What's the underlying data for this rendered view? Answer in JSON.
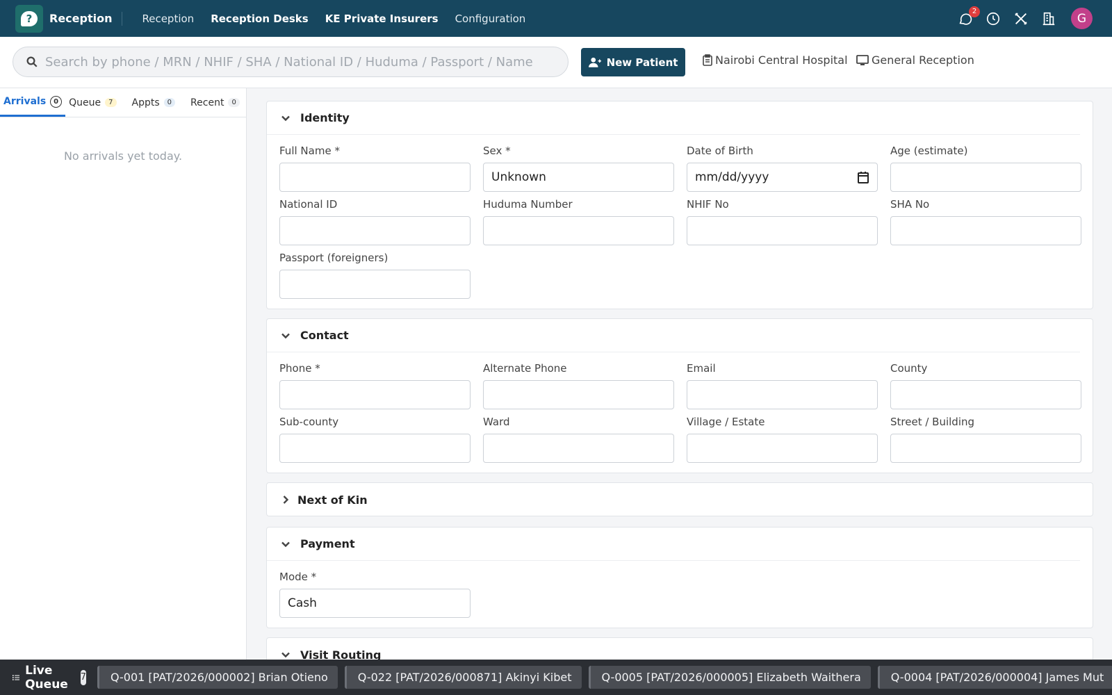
{
  "app": {
    "name": "Reception"
  },
  "nav": [
    "Reception",
    "Reception Desks",
    "KE Private Insurers",
    "Configuration"
  ],
  "notifications": {
    "count": "2"
  },
  "user": {
    "initial": "G"
  },
  "search": {
    "placeholder": "Search by phone / MRN / NHIF / SHA / National ID / Huduma / Passport / Name"
  },
  "actions": {
    "new_patient": "New Patient"
  },
  "context": {
    "facility": "Nairobi Central Hospital",
    "desk": "General Reception"
  },
  "left_tabs": [
    {
      "label": "Arrivals",
      "count": "0"
    },
    {
      "label": "Queue",
      "count": "7"
    },
    {
      "label": "Appts",
      "count": "0"
    },
    {
      "label": "Recent",
      "count": "0"
    }
  ],
  "left_empty": "No arrivals yet today.",
  "identity": {
    "title": "Identity",
    "full_name": "Full Name *",
    "sex": "Sex *",
    "sex_value": "Unknown",
    "dob": "Date of Birth",
    "dob_placeholder": "mm/dd/yyyy",
    "age": "Age (estimate)",
    "national_id": "National ID",
    "huduma": "Huduma Number",
    "nhif": "NHIF No",
    "sha": "SHA No",
    "passport": "Passport (foreigners)"
  },
  "contact": {
    "title": "Contact",
    "phone": "Phone *",
    "alt_phone": "Alternate Phone",
    "email": "Email",
    "county": "County",
    "subcounty": "Sub-county",
    "ward": "Ward",
    "village": "Village / Estate",
    "street": "Street / Building"
  },
  "next_of_kin": {
    "title": "Next of Kin"
  },
  "payment": {
    "title": "Payment",
    "mode": "Mode *",
    "mode_value": "Cash"
  },
  "visit_routing": {
    "title": "Visit Routing"
  },
  "live_queue": {
    "title": "Live Queue",
    "count": "7",
    "items": [
      "Q-001 [PAT/2026/000002] Brian Otieno",
      "Q-022 [PAT/2026/000871] Akinyi Kibet",
      "Q-0005 [PAT/2026/000005] Elizabeth Waithera",
      "Q-0004 [PAT/2026/000004] James Mut"
    ]
  }
}
